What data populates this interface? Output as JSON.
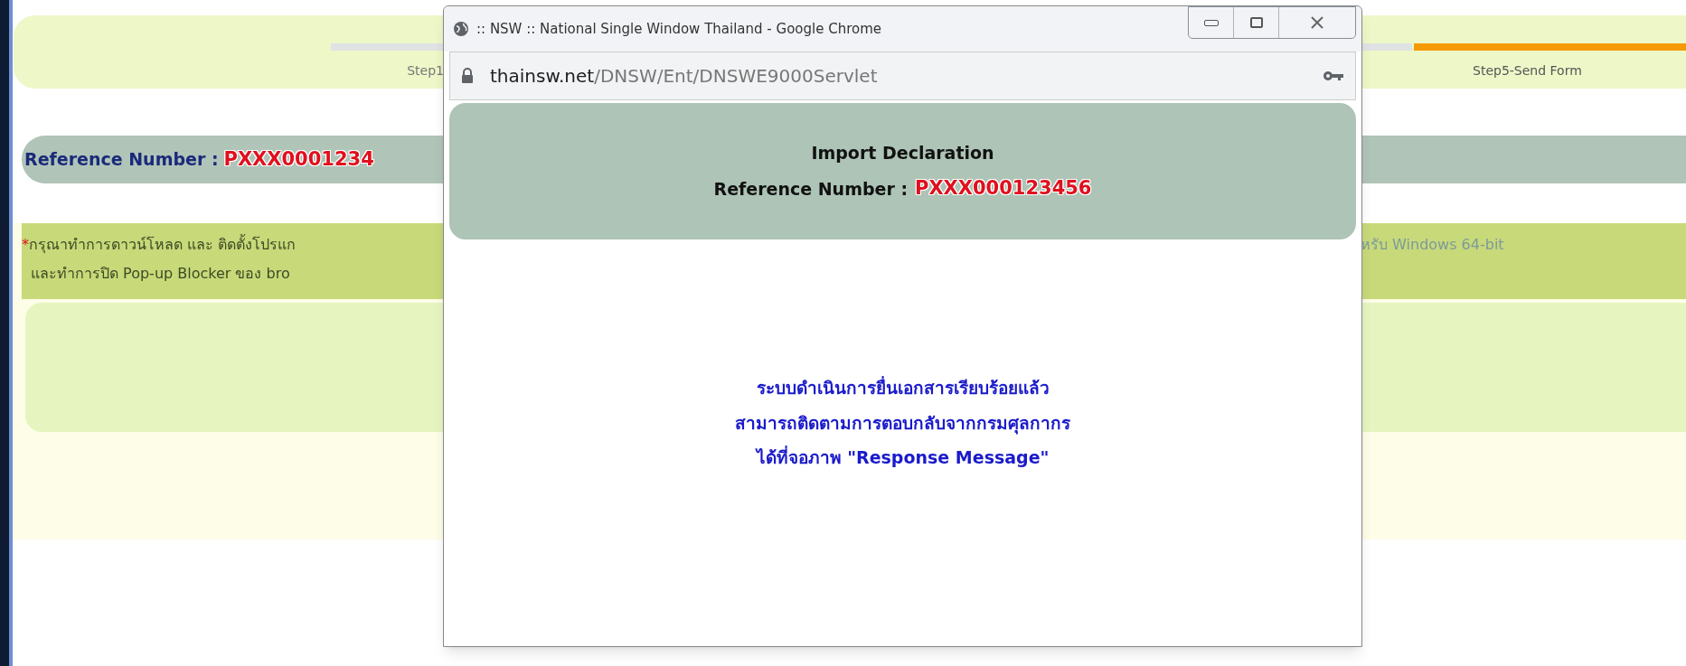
{
  "steps": [
    {
      "label": "Step1",
      "selected": false
    },
    {
      "label": "Step5-Send Form",
      "selected": true
    }
  ],
  "reference": {
    "label": "Reference Number :",
    "value": "PXXX0001234"
  },
  "notice": {
    "mark": "*",
    "line_1_left": "กรุณาทำการดาวน์โหลด และ ติดตั้งโปรแก",
    "line_1_right": "หรับ Windows 64-bit",
    "line_2_left": "และทำการปิด Pop-up Blocker ของ bro"
  },
  "popup": {
    "title": ":: NSW :: National Single Window Thailand - Google Chrome",
    "url_host": "thainsw.net",
    "url_path": "/DNSW/Ent/DNSWE9000Servlet",
    "heading": "Import Declaration",
    "reference_label": "Reference Number :",
    "reference_value": "PXXX000123456",
    "message": [
      "ระบบดำเนินการยื่นเอกสารเรียบร้อยแล้ว",
      "สามารถติดตามการตอบกลับจากกรมศุลกากร",
      "ได้ที่จอภาพ \"Response Message\""
    ]
  }
}
